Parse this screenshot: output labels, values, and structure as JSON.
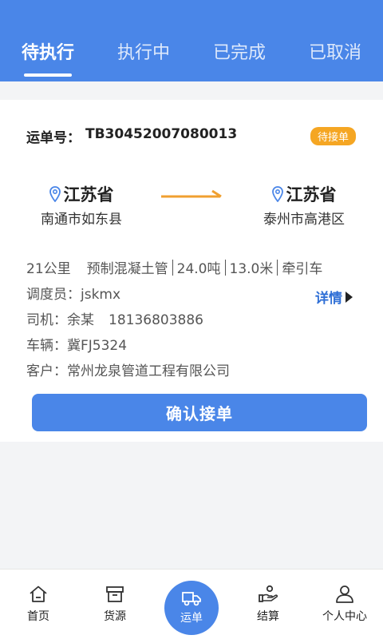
{
  "tabs": [
    {
      "label": "待执行",
      "active": true
    },
    {
      "label": "执行中",
      "active": false
    },
    {
      "label": "已完成",
      "active": false
    },
    {
      "label": "已取消",
      "active": false
    }
  ],
  "order": {
    "number_label": "运单号：",
    "number": "TB30452007080013",
    "status_badge": "待接单",
    "from": {
      "province": "江苏省",
      "city": "南通市如东县"
    },
    "to": {
      "province": "江苏省",
      "city": "泰州市高港区"
    },
    "distance": "21公里",
    "cargo": "预制混凝土管",
    "weight": "24.0吨",
    "length": "13.0米",
    "vehicle_type": "牵引车",
    "dispatcher_label": "调度员：",
    "dispatcher": "jskmx",
    "driver_label": "司机：",
    "driver_name": "余某",
    "driver_phone": "18136803886",
    "vehicle_label": "车辆：",
    "vehicle_plate": "冀FJ5324",
    "customer_label": "客户：",
    "customer": "常州龙泉管道工程有限公司",
    "detail_link": "详情",
    "confirm_button": "确认接单"
  },
  "bottom_nav": [
    {
      "label": "首页",
      "icon": "home-icon"
    },
    {
      "label": "货源",
      "icon": "box-icon"
    },
    {
      "label": "运单",
      "icon": "truck-icon",
      "active": true
    },
    {
      "label": "结算",
      "icon": "hand-coin-icon"
    },
    {
      "label": "个人中心",
      "icon": "person-icon"
    }
  ],
  "colors": {
    "primary": "#4a86e8",
    "badge": "#f5a623",
    "link": "#2f6fd6"
  }
}
